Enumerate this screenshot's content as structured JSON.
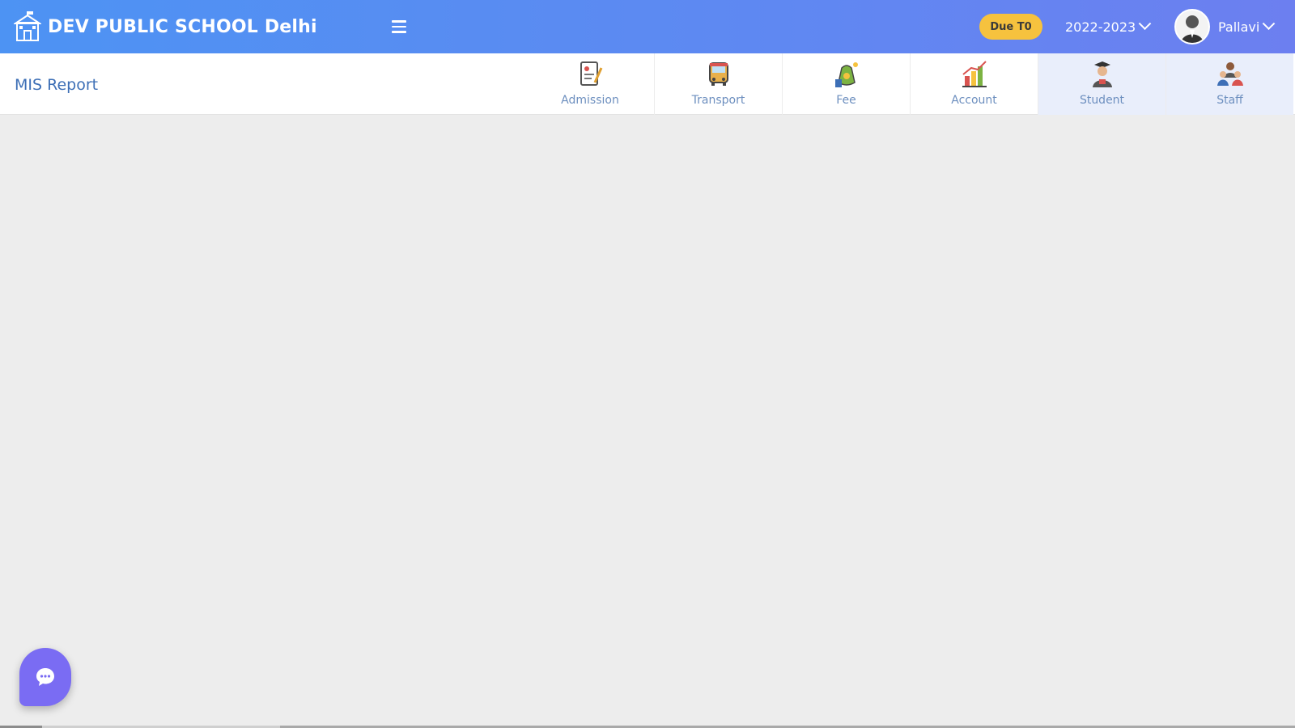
{
  "header": {
    "school_name": "DEV PUBLIC SCHOOL Delhi",
    "due_badge": "Due T0",
    "session": "2022-2023",
    "user_name": "Pallavi"
  },
  "subheader": {
    "title": "MIS Report",
    "modules": [
      {
        "label": "Admission",
        "icon": "admission-icon"
      },
      {
        "label": "Transport",
        "icon": "bus-icon"
      },
      {
        "label": "Fee",
        "icon": "money-bag-icon"
      },
      {
        "label": "Account",
        "icon": "account-chart-icon"
      },
      {
        "label": "Student",
        "icon": "student-icon"
      },
      {
        "label": "Staff",
        "icon": "staff-icon"
      }
    ]
  },
  "colors": {
    "topbar_start": "#4d93f3",
    "topbar_end": "#6c7ff0",
    "badge": "#f6c23e",
    "title": "#3d6fb6",
    "chat_fab": "#7a6cf3",
    "background": "#ededed"
  }
}
